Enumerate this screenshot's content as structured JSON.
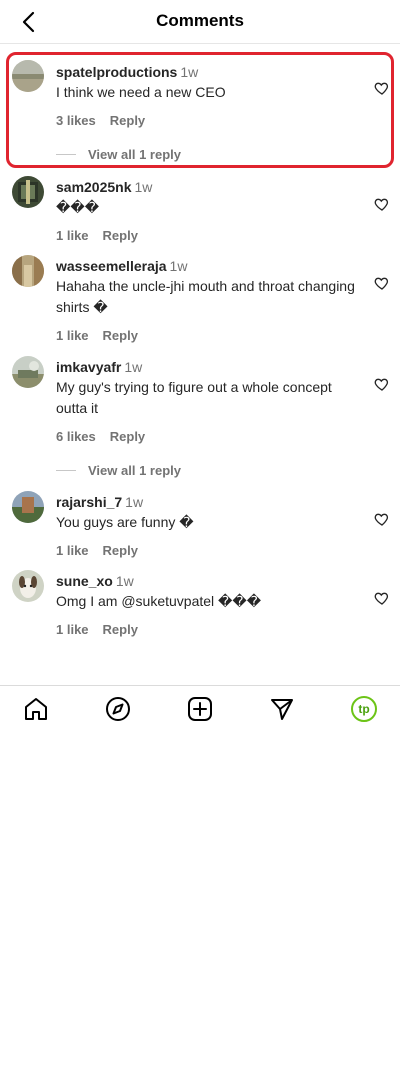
{
  "header": {
    "title": "Comments"
  },
  "comments": [
    {
      "username": "spatelproductions",
      "time": "1w",
      "text": "I think we need a new CEO",
      "likes": "3 likes",
      "reply_label": "Reply",
      "view_replies": "View all 1 reply"
    },
    {
      "username": "sam2025nk",
      "time": "1w",
      "text": "���",
      "likes": "1 like",
      "reply_label": "Reply"
    },
    {
      "username": "wasseemelleraja",
      "time": "1w",
      "text": "Hahaha the uncle-jhi mouth and throat changing shirts �",
      "likes": "1 like",
      "reply_label": "Reply"
    },
    {
      "username": "imkavyafr",
      "time": "1w",
      "text": "My guy's trying to figure out a whole concept outta it",
      "likes": "6 likes",
      "reply_label": "Reply",
      "view_replies": "View all 1 reply"
    },
    {
      "username": "rajarshi_7",
      "time": "1w",
      "text": "You guys are funny �",
      "likes": "1 like",
      "reply_label": "Reply"
    },
    {
      "username": "sune_xo",
      "time": "1w",
      "text": "Omg I am @suketuvpatel ���",
      "likes": "1 like",
      "reply_label": "Reply"
    }
  ],
  "nav": {
    "profile_initials": "tp",
    "accent_color": "#6cc417"
  },
  "colors": {
    "highlight": "#e0242f",
    "secondary_text": "#737373"
  },
  "icons": [
    "back-arrow-icon",
    "heart-icon",
    "home-icon",
    "explore-compass-icon",
    "create-plus-icon",
    "direct-message-send-icon"
  ]
}
